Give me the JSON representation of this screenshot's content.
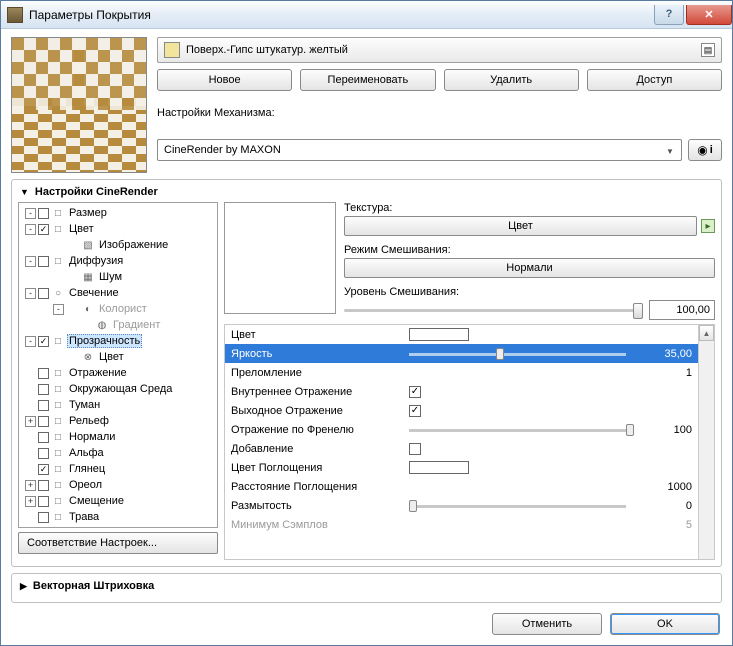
{
  "window": {
    "title": "Параметры Покрытия"
  },
  "material": {
    "name": "Поверх.-Гипс штукатур. желтый"
  },
  "buttons": {
    "new": "Новое",
    "rename": "Переименовать",
    "delete": "Удалить",
    "access": "Доступ"
  },
  "mech": {
    "label": "Настройки Механизма:",
    "value": "CineRender by MAXON"
  },
  "sections": {
    "cine": "Настройки CineRender",
    "hatch": "Векторная Штриховка"
  },
  "tree": {
    "items": [
      {
        "exp": "-",
        "chk": false,
        "icon": "□",
        "label": "Размер",
        "ind": 0
      },
      {
        "exp": "-",
        "chk": true,
        "icon": "□",
        "label": "Цвет",
        "ind": 0
      },
      {
        "exp": "",
        "chk": null,
        "icon": "▧",
        "label": "Изображение",
        "ind": 2
      },
      {
        "exp": "-",
        "chk": false,
        "icon": "□",
        "label": "Диффузия",
        "ind": 0
      },
      {
        "exp": "",
        "chk": null,
        "icon": "▦",
        "label": "Шум",
        "ind": 2
      },
      {
        "exp": "-",
        "chk": false,
        "icon": "○",
        "label": "Свечение",
        "ind": 0
      },
      {
        "exp": "-",
        "chk": null,
        "icon": "◐",
        "label": "Колорист",
        "ind": 2,
        "dim": true
      },
      {
        "exp": "",
        "chk": null,
        "icon": "◍",
        "label": "Градиент",
        "ind": 3,
        "dim": true
      },
      {
        "exp": "-",
        "chk": true,
        "icon": "□",
        "label": "Прозрачность",
        "ind": 0,
        "sel": true
      },
      {
        "exp": "",
        "chk": null,
        "icon": "⊗",
        "label": "Цвет",
        "ind": 2
      },
      {
        "exp": "",
        "chk": false,
        "icon": "□",
        "label": "Отражение",
        "ind": 0
      },
      {
        "exp": "",
        "chk": false,
        "icon": "□",
        "label": "Окружающая Среда",
        "ind": 0
      },
      {
        "exp": "",
        "chk": false,
        "icon": "□",
        "label": "Туман",
        "ind": 0
      },
      {
        "exp": "+",
        "chk": false,
        "icon": "□",
        "label": "Рельеф",
        "ind": 0
      },
      {
        "exp": "",
        "chk": false,
        "icon": "□",
        "label": "Нормали",
        "ind": 0
      },
      {
        "exp": "",
        "chk": false,
        "icon": "□",
        "label": "Альфа",
        "ind": 0
      },
      {
        "exp": "",
        "chk": true,
        "icon": "□",
        "label": "Глянец",
        "ind": 0
      },
      {
        "exp": "+",
        "chk": false,
        "icon": "□",
        "label": "Ореол",
        "ind": 0
      },
      {
        "exp": "+",
        "chk": false,
        "icon": "□",
        "label": "Смещение",
        "ind": 0
      },
      {
        "exp": "",
        "chk": false,
        "icon": "□",
        "label": "Трава",
        "ind": 0
      }
    ],
    "match": "Соответствие Настроек..."
  },
  "tex": {
    "texture_lbl": "Текстура:",
    "texture_btn": "Цвет",
    "mix_lbl": "Режим Смешивания:",
    "mix_btn": "Нормали",
    "level_lbl": "Уровень Смешивания:",
    "level_val": "100,00"
  },
  "props": [
    {
      "name": "Цвет",
      "type": "swatch"
    },
    {
      "name": "Яркость",
      "type": "slider",
      "thumb": 40,
      "num": "35,00",
      "sel": true
    },
    {
      "name": "Преломление",
      "type": "num",
      "num": "1"
    },
    {
      "name": "Внутреннее Отражение",
      "type": "check",
      "on": true
    },
    {
      "name": "Выходное Отражение",
      "type": "check",
      "on": true
    },
    {
      "name": "Отражение по Френелю",
      "type": "slider",
      "thumb": 100,
      "num": "100"
    },
    {
      "name": "Добавление",
      "type": "check",
      "on": false
    },
    {
      "name": "Цвет Поглощения",
      "type": "swatch"
    },
    {
      "name": "Расстояние Поглощения",
      "type": "num",
      "num": "1000"
    },
    {
      "name": "Размытость",
      "type": "slider",
      "thumb": 0,
      "num": "0"
    },
    {
      "name": "Минимум Сэмплов",
      "type": "num",
      "num": "5",
      "dim": true
    }
  ],
  "footer": {
    "cancel": "Отменить",
    "ok": "OK"
  }
}
